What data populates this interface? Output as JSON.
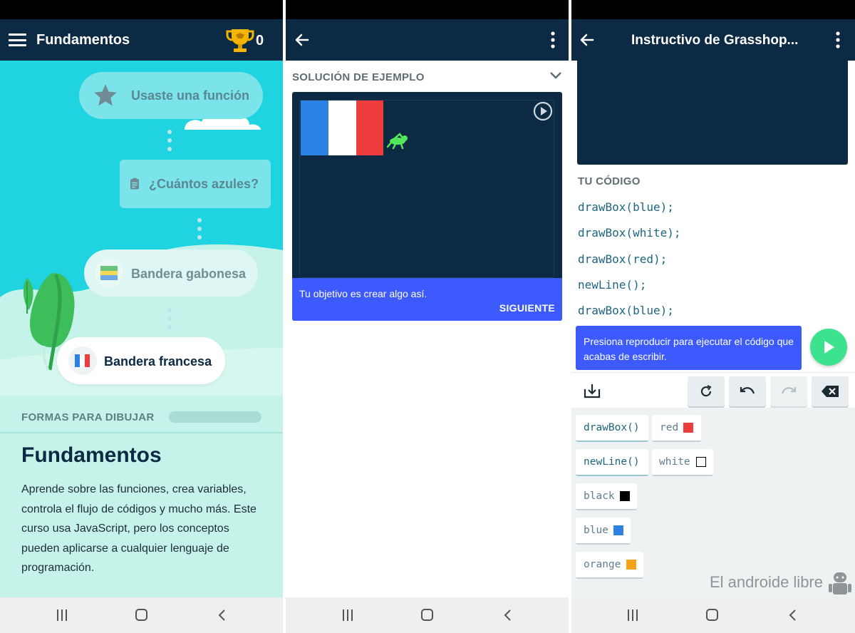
{
  "colors": {
    "appbar": "#0c2a43",
    "accent_blue": "#3d5afe",
    "map_cyan": "#1fd3e0",
    "map_hill": "#c5f3ea",
    "play_green": "#3de28f",
    "code_teal": "#1e6580",
    "flag_blue": "#2b82e4",
    "flag_red": "#ef3d3d",
    "trophy_gold": "#f5b400"
  },
  "panel1": {
    "header": {
      "menu_icon": "menu-icon",
      "title": "Fundamentos",
      "trophy_icon": "trophy-icon",
      "trophy_count": "0"
    },
    "lessons": [
      {
        "label": "Usaste una función",
        "icon": "star-icon"
      },
      {
        "label": "¿Cuántos azules?",
        "icon": "clipboard-icon"
      },
      {
        "label": "Bandera gabonesa",
        "icon": "gabon-flag-icon"
      },
      {
        "label": "Bandera francesa",
        "icon": "france-flag-icon"
      }
    ],
    "next_section": "FORMAS PARA DIBUJAR",
    "course_title": "Fundamentos",
    "course_description": "Aprende sobre las funciones, crea variables, controla el flujo de códigos y mucho más. Este curso usa JavaScript, pero los conceptos pueden aplicarse a cualquier lenguaje de programación."
  },
  "panel2": {
    "header": {
      "back_icon": "arrow-left-icon",
      "more_icon": "more-vertical-icon"
    },
    "section_label": "SOLUCIÓN DE EJEMPLO",
    "tooltip_text": "Tu objetivo es crear algo así.",
    "next_button": "SIGUIENTE"
  },
  "panel3": {
    "header": {
      "back_icon": "arrow-left-icon",
      "title": "Instructivo de Grasshop...",
      "more_icon": "more-vertical-icon"
    },
    "code_label": "TU CÓDIGO",
    "code_lines": [
      "drawBox(blue);",
      "drawBox(white);",
      "drawBox(red);",
      "newLine();",
      "drawBox(blue);"
    ],
    "hint_text": "Presiona reproducir para ejecutar el código que acabas de escribir.",
    "toolbar_icons": [
      "download-icon",
      "refresh-icon",
      "undo-icon",
      "redo-icon",
      "backspace-icon"
    ],
    "keys": {
      "drawbox": "drawBox()",
      "newline": "newLine()",
      "red": "red",
      "white": "white",
      "black": "black",
      "blue": "blue",
      "orange": "orange"
    },
    "watermark": "El androide libre"
  }
}
